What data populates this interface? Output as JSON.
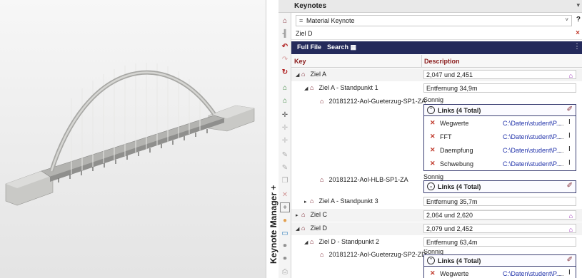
{
  "panel": {
    "vertical_title": "Keynote Manager +",
    "title": "Keynotes",
    "menu_glyph": "▾"
  },
  "filter": {
    "eq": "=",
    "value": "Material Keynote",
    "chevron": "˅",
    "help": "?"
  },
  "search": {
    "value": "Ziel D",
    "close": "×"
  },
  "tabs": {
    "full_file": "Full File",
    "search": "Search"
  },
  "columns": {
    "key": "Key",
    "description": "Description"
  },
  "rows": [
    {
      "key": "Ziel A",
      "desc": "2,047 und 2,451"
    },
    {
      "key": "Ziel A - Standpunkt 1",
      "desc": "Entfernung 34,9m"
    },
    {
      "key": "20181212-Aol-Gueterzug-SP1-ZA",
      "desc": "Sonnig"
    },
    {
      "key": "20181212-Aol-HLB-SP1-ZA",
      "desc": "Sonnig"
    },
    {
      "key": "Ziel A - Standpunkt 3",
      "desc": "Entfernung 35,7m"
    },
    {
      "key": "Ziel C",
      "desc": "2,064 und 2,620"
    },
    {
      "key": "Ziel D",
      "desc": "2,079 und 2,452"
    },
    {
      "key": "Ziel D - Standpunkt 2",
      "desc": "Entfernung 63,4m"
    },
    {
      "key": "20181212-Aol-Gueterzug-SP2-ZD",
      "desc": "Sonnig"
    }
  ],
  "links_header": "Links (4 Total)",
  "links": [
    {
      "name": "Wegwerte",
      "path": "C:\\Daten\\student\\P...",
      "more": "..."
    },
    {
      "name": "FFT",
      "path": "C:\\Daten\\student\\P...",
      "more": "..."
    },
    {
      "name": "Daempfung",
      "path": "C:\\Daten\\student\\P...",
      "more": "..."
    },
    {
      "name": "Schwebung",
      "path": "C:\\Daten\\student\\P...",
      "more": "..."
    }
  ],
  "icons": {
    "tree_expanded": "◢",
    "tree_collapsed": "▸",
    "keynote": "house-icon",
    "link_remove": "x-icon",
    "link_cursor": "I",
    "marker": "⌂"
  },
  "colors": {
    "tabbar": "#242a5b",
    "key_header": "#8a1b1b",
    "link_path": "#2233aa",
    "marker": "#9b2bb8"
  }
}
